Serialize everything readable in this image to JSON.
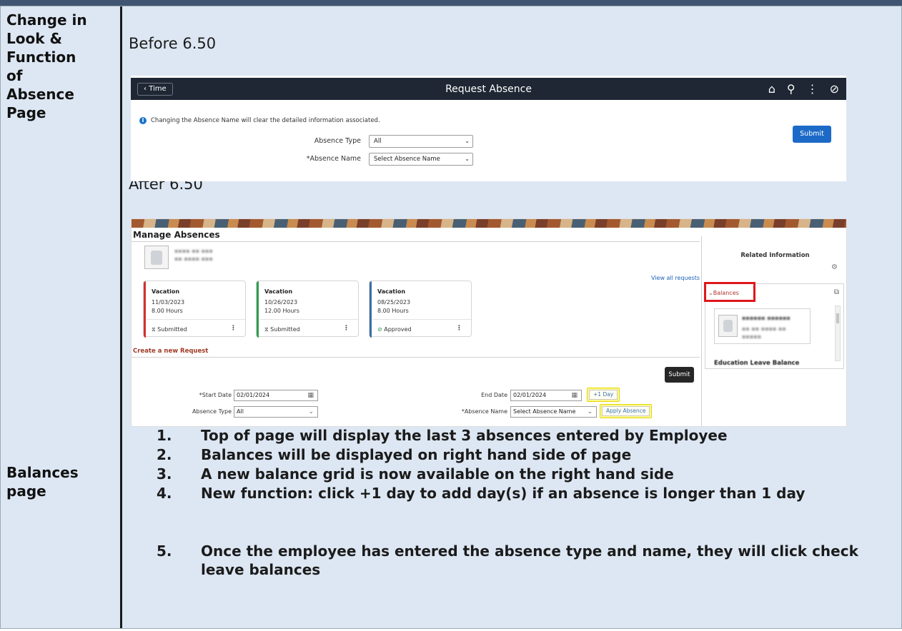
{
  "labels": {
    "change": "Change in\nLook &\nFunction\nof\nAbsence\nPage",
    "balances": "Balances\npage"
  },
  "before": {
    "heading": "Before 6.50",
    "back_label": "Time",
    "page_title": "Request Absence",
    "info_message": "Changing the Absence Name will clear the detailed information associated.",
    "submit_label": "Submit",
    "absence_type_label": "Absence Type",
    "absence_type_value": "All",
    "absence_name_label": "*Absence Name",
    "absence_name_value": "Select Absence Name"
  },
  "after": {
    "heading": "After 6.50",
    "page_title": "Manage Absences",
    "view_all": "View all requests",
    "cards": [
      {
        "type": "Vacation",
        "date": "11/03/2023",
        "hours": "8.00 Hours",
        "status": "Submitted",
        "status_icon": "⧖",
        "color": "#d32f2f"
      },
      {
        "type": "Vacation",
        "date": "10/26/2023",
        "hours": "12.00 Hours",
        "status": "Submitted",
        "status_icon": "⧖",
        "color": "#2e9e4e"
      },
      {
        "type": "Vacation",
        "date": "08/25/2023",
        "hours": "8.00 Hours",
        "status": "Approved",
        "status_icon": "⊘",
        "color": "#3a6ea5"
      }
    ],
    "create_link": "Create a new Request",
    "submit_label": "Submit",
    "start_date_label": "*Start Date",
    "start_date_value": "02/01/2024",
    "end_date_label": "End Date",
    "end_date_value": "02/01/2024",
    "plus_day": "+1 Day",
    "absence_type_label": "Absence Type",
    "absence_type_value": "All",
    "absence_name_label": "*Absence Name",
    "absence_name_value": "Select Absence Name",
    "apply_absence": "Apply Absence",
    "related_title": "Related Information",
    "balances_label": "Balances",
    "education_label": "Education Leave Balance"
  },
  "bullets": [
    {
      "num": "1.",
      "text": "Top of page will display the last 3 absences entered by Employee"
    },
    {
      "num": "2.",
      "text": "Balances will be displayed on right hand side of page"
    },
    {
      "num": "3.",
      "text": "A new balance grid is now available on the right hand side"
    },
    {
      "num": "4.",
      "text": "New function: click +1 day to add day(s) if an absence is longer than 1 day"
    },
    {
      "num": "5.",
      "text": "Once the employee has entered the absence type and name, they will click check leave balances"
    }
  ]
}
